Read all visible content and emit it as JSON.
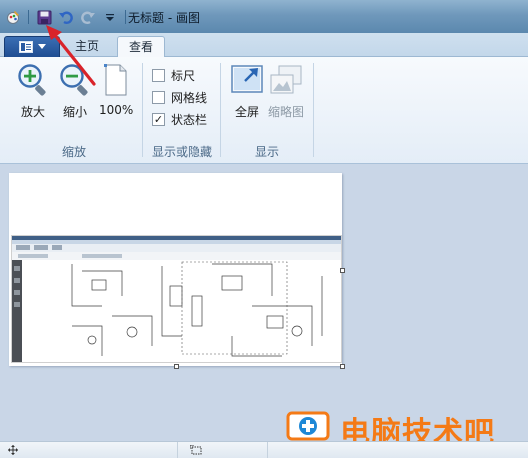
{
  "window": {
    "title": "无标题 - 画图"
  },
  "quick_access": {
    "items": [
      "app-icon",
      "save-icon",
      "undo-icon",
      "redo-icon",
      "customize-dropdown-icon"
    ]
  },
  "tabs": [
    {
      "label": "主页"
    },
    {
      "label": "查看"
    }
  ],
  "groups": {
    "zoom": {
      "label": "缩放",
      "zoom_in": "放大",
      "zoom_out": "缩小",
      "actual_size": "100%"
    },
    "show_hide": {
      "label": "显示或隐藏",
      "ruler": "标尺",
      "gridlines": "网格线",
      "statusbar": "状态栏",
      "ruler_checked": false,
      "gridlines_checked": false,
      "statusbar_checked": true,
      "check_mark": "✓"
    },
    "display": {
      "label": "显示",
      "fullscreen": "全屏",
      "thumbnail": "缩略图"
    }
  },
  "watermark": {
    "text": "电脑技术吧"
  },
  "colors": {
    "accent": "#1f4d92",
    "arrow": "#d9232a",
    "watermark": "#f47a16",
    "workspace": "#c9d6e7"
  }
}
